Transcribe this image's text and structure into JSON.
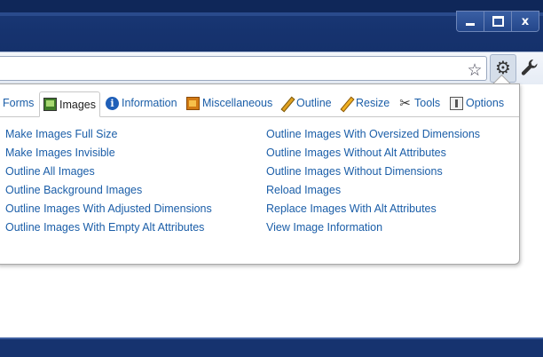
{
  "window": {
    "controls": {
      "minimize": "",
      "maximize": "",
      "close": "x"
    }
  },
  "toolbar": {
    "icons": [
      "star-icon",
      "gear-icon",
      "wrench-icon"
    ]
  },
  "panel": {
    "tabs": [
      {
        "label": "Forms",
        "icon": ""
      },
      {
        "label": "Images",
        "icon": "images-icon",
        "active": true
      },
      {
        "label": "Information",
        "icon": "info-icon"
      },
      {
        "label": "Miscellaneous",
        "icon": "miscellaneous-icon"
      },
      {
        "label": "Outline",
        "icon": "pencil-icon"
      },
      {
        "label": "Resize",
        "icon": "pencil-icon"
      },
      {
        "label": "Tools",
        "icon": "tools-icon"
      },
      {
        "label": "Options",
        "icon": "options-icon"
      }
    ],
    "left_links": [
      "Make Images Full Size",
      "Make Images Invisible",
      "Outline All Images",
      "Outline Background Images",
      "Outline Images With Adjusted Dimensions",
      "Outline Images With Empty Alt Attributes"
    ],
    "right_links": [
      "Outline Images With Oversized Dimensions",
      "Outline Images Without Alt Attributes",
      "Outline Images Without Dimensions",
      "Reload Images",
      "Replace Images With Alt Attributes",
      "View Image Information"
    ]
  },
  "colors": {
    "link": "#1b5ea8",
    "frame": "#16336f"
  }
}
